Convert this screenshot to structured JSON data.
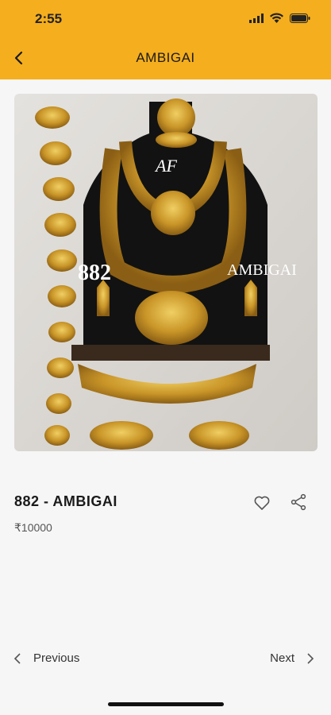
{
  "status_bar": {
    "time": "2:55"
  },
  "header": {
    "title": "AMBIGAI"
  },
  "product": {
    "image_overlay": {
      "code": "882",
      "brand": "AMBIGAI",
      "logo": "AF"
    },
    "title": "882 - AMBIGAI",
    "price": "₹10000"
  },
  "pager": {
    "previous_label": "Previous",
    "next_label": "Next"
  },
  "colors": {
    "header_bg": "#f5ae1e",
    "page_bg": "#f6f6f6",
    "gold": "#d4a22c"
  },
  "icons": [
    "back-arrow-icon",
    "signal-icon",
    "wifi-icon",
    "battery-icon",
    "heart-icon",
    "share-icon",
    "chevron-left-icon",
    "chevron-right-icon"
  ]
}
